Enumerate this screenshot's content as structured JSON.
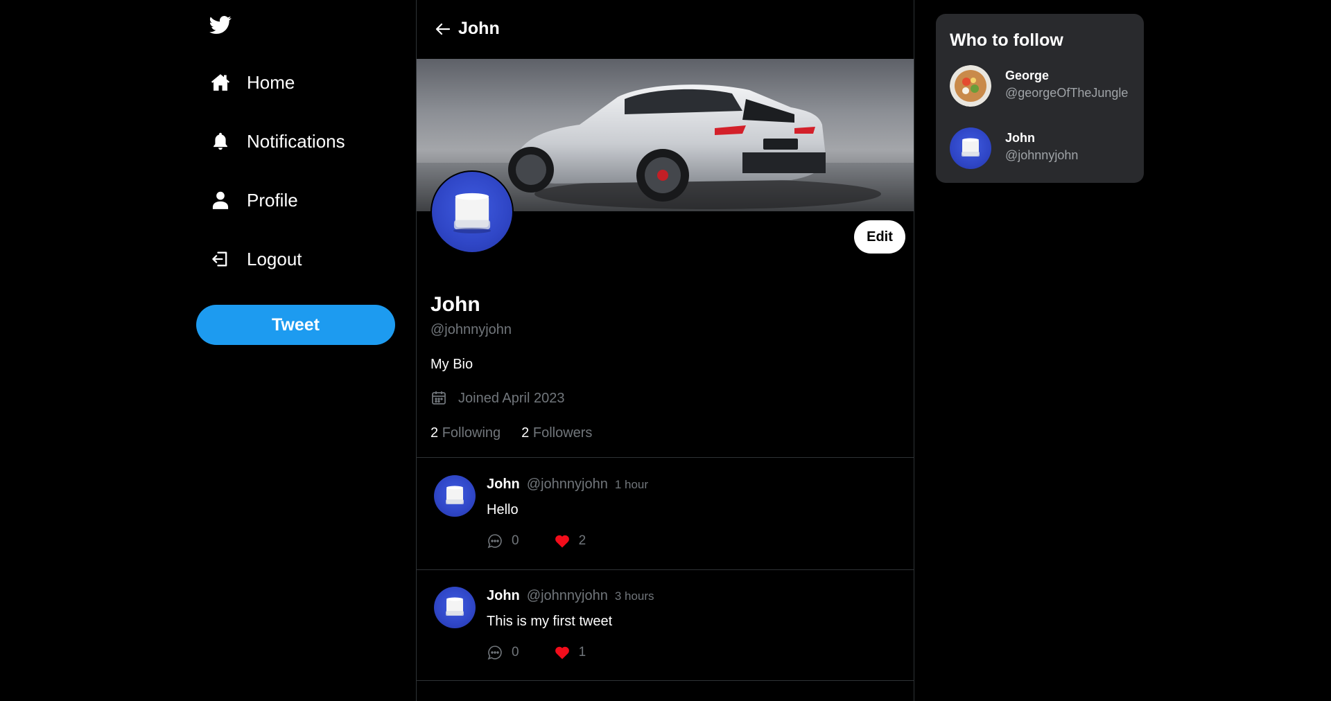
{
  "sidebar": {
    "logo_icon": "twitter-bird-icon",
    "items": [
      {
        "label": "Home",
        "icon": "home-icon"
      },
      {
        "label": "Notifications",
        "icon": "bell-icon"
      },
      {
        "label": "Profile",
        "icon": "user-icon"
      },
      {
        "label": "Logout",
        "icon": "logout-icon"
      }
    ],
    "tweet_label": "Tweet"
  },
  "header": {
    "back_icon": "arrow-left-icon",
    "title": "John"
  },
  "profile": {
    "name": "John",
    "handle": "@johnnyjohn",
    "bio": "My Bio",
    "joined": "Joined April 2023",
    "edit_label": "Edit",
    "following_count": "2",
    "following_label": "Following",
    "followers_count": "2",
    "followers_label": "Followers"
  },
  "tweets": [
    {
      "name": "John",
      "handle": "@johnnyjohn",
      "time": "1 hour",
      "text": "Hello",
      "replies": "0",
      "likes": "2"
    },
    {
      "name": "John",
      "handle": "@johnnyjohn",
      "time": "3 hours",
      "text": "This is my first tweet",
      "replies": "0",
      "likes": "1"
    }
  ],
  "who_to_follow": {
    "title": "Who to follow",
    "users": [
      {
        "name": "George",
        "handle": "@georgeOfTheJungle"
      },
      {
        "name": "John",
        "handle": "@johnnyjohn"
      }
    ]
  },
  "colors": {
    "accent": "#1d9bf0",
    "like": "#f91880",
    "panel": "#292a2d",
    "muted": "#71767b"
  }
}
